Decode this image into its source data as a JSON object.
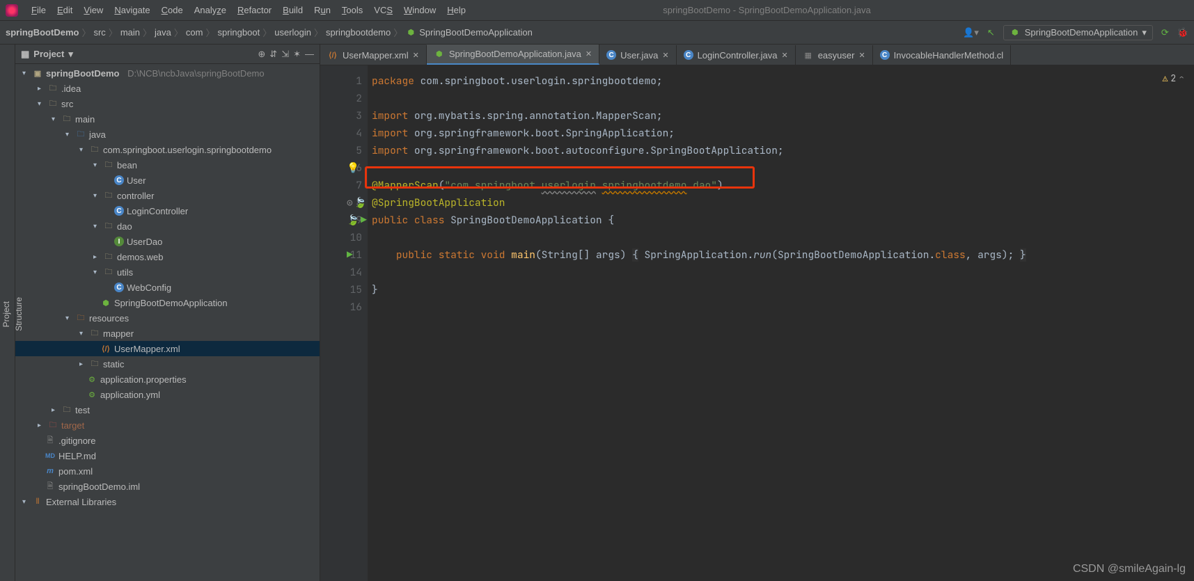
{
  "title": "springBootDemo - SpringBootDemoApplication.java",
  "menu": [
    "File",
    "Edit",
    "View",
    "Navigate",
    "Code",
    "Analyze",
    "Refactor",
    "Build",
    "Run",
    "Tools",
    "VCS",
    "Window",
    "Help"
  ],
  "breadcrumb": [
    "springBootDemo",
    "src",
    "main",
    "java",
    "com",
    "springboot",
    "userlogin",
    "springbootdemo",
    "SpringBootDemoApplication"
  ],
  "run_config": "SpringBootDemoApplication",
  "panel_title": "Project",
  "problems_count": "2",
  "watermark": "CSDN @smileAgain-lg",
  "tree": {
    "root": "springBootDemo",
    "root_path": "D:\\NCB\\ncbJava\\springBootDemo",
    "idea": ".idea",
    "src": "src",
    "main": "main",
    "java": "java",
    "pkg": "com.springboot.userlogin.springbootdemo",
    "bean": "bean",
    "user": "User",
    "controller": "controller",
    "logincontroller": "LoginController",
    "dao": "dao",
    "userdao": "UserDao",
    "demosweb": "demos.web",
    "utils": "utils",
    "webconfig": "WebConfig",
    "sbapp": "SpringBootDemoApplication",
    "resources": "resources",
    "mapper": "mapper",
    "usermapper": "UserMapper.xml",
    "static": "static",
    "appprops": "application.properties",
    "appyml": "application.yml",
    "test": "test",
    "target": "target",
    "gitignore": ".gitignore",
    "help": "HELP.md",
    "pom": "pom.xml",
    "iml": "springBootDemo.iml",
    "extlib": "External Libraries"
  },
  "tabs": [
    {
      "label": "UserMapper.xml",
      "icon": "xml"
    },
    {
      "label": "SpringBootDemoApplication.java",
      "icon": "spring",
      "active": true
    },
    {
      "label": "User.java",
      "icon": "class"
    },
    {
      "label": "LoginController.java",
      "icon": "class"
    },
    {
      "label": "easyuser",
      "icon": "table"
    },
    {
      "label": "InvocableHandlerMethod.cl",
      "icon": "class"
    }
  ],
  "gutter": [
    "1",
    "2",
    "3",
    "4",
    "5",
    "6",
    "7",
    "8",
    "9",
    "10",
    "11",
    "14",
    "15",
    "16"
  ],
  "code": {
    "l1_kw": "package",
    "l1_rest": " com.springboot.userlogin.springbootdemo;",
    "l3_kw": "import",
    "l3_rest": " org.mybatis.spring.annotation.MapperScan;",
    "l4_kw": "import",
    "l4_rest": " org.springframework.boot.SpringApplication;",
    "l5_kw": "import",
    "l5_rest": " org.springframework.boot.autoconfigure.SpringBootApplication;",
    "l7_ann": "@MapperScan",
    "l7_p": "(",
    "l7_str": "\"com.springboot.",
    "l7_u1": "userlogin",
    "l7_d1": ".",
    "l7_u2": "springbootdemo",
    "l7_d2": ".dao\"",
    "l7_cp": ")",
    "l8_ann": "@SpringBootApplication",
    "l9_pub": "public class ",
    "l9_cls": "SpringBootDemoApplication ",
    "l9_b": "{",
    "l11_ind": "    ",
    "l11_p": "public static void ",
    "l11_m": "main",
    "l11_args": "(String[] args) ",
    "l11_ob": "{",
    "l11_sp": " SpringApplication.",
    "l11_run": "run",
    "l11_r2": "(SpringBootDemoApplication.",
    "l11_cl": "class",
    "l11_r3": ", args); ",
    "l11_cb": "}",
    "l14": "}",
    "l15": ""
  },
  "sidebar_tabs": {
    "project": "Project",
    "structure": "Structure"
  }
}
